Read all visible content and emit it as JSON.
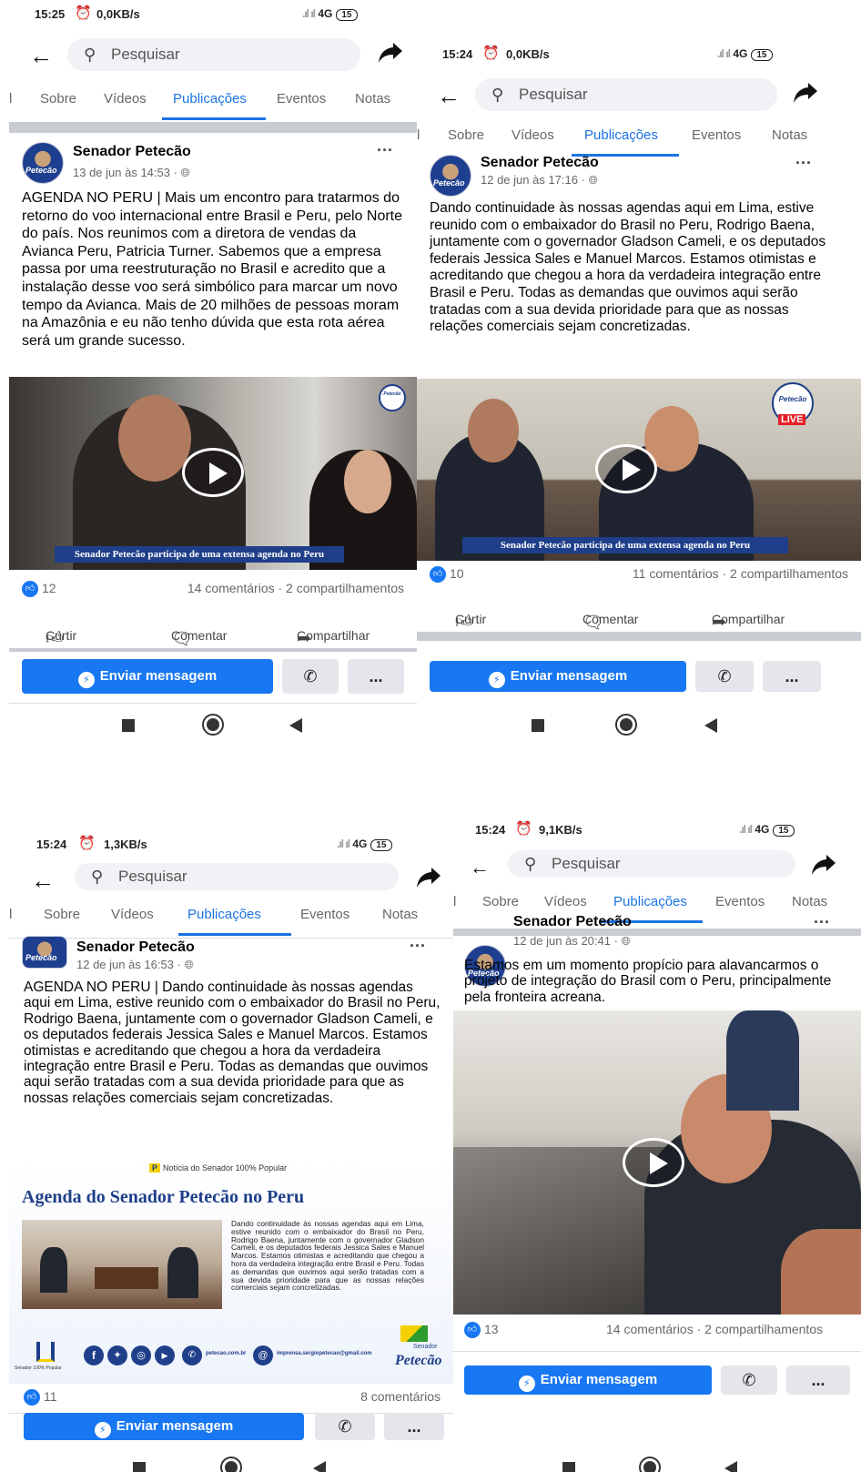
{
  "tabs": [
    "l",
    "Sobre",
    "Vídeos",
    "Publicações",
    "Eventos",
    "Notas"
  ],
  "search_placeholder": "Pesquisar",
  "page_name": "Senador Petecão",
  "actions": {
    "like": "Curtir",
    "comment": "Comentar",
    "share": "Compartilhar"
  },
  "message_button": "Enviar mensagem",
  "more_label": "...",
  "avatar_mark": "Petecão",
  "live_label": "LIVE",
  "video_caption": "Senador Petecão participa de uma extensa agenda no Peru",
  "panels": [
    {
      "status": {
        "time": "15:25",
        "speed": "0,0KB/s",
        "network": "4G",
        "battery": "15"
      },
      "post": {
        "date": "13 de jun às 14:53 · ",
        "text": "AGENDA NO PERU | Mais um encontro para tratarmos do retorno do voo internacional entre Brasil e Peru, pelo Norte do país. Nos reunimos com a diretora de vendas da Avianca Peru, Patricia Turner. Sabemos que a empresa passa por uma reestruturação no Brasil e acredito que a instalação desse voo será simbólico para marcar um novo tempo da Avianca. Mais de 20 milhões de pessoas moram na Amazônia e eu não tenho dúvida que esta rota aérea será um grande sucesso.",
        "likes": "12",
        "comments_shares": "14 comentários · 2 compartilhamentos"
      }
    },
    {
      "status": {
        "time": "15:24",
        "speed": "0,0KB/s",
        "network": "4G",
        "battery": "15"
      },
      "post": {
        "date": "12 de jun às 17:16 · ",
        "text": "Dando continuidade às nossas agendas aqui em Lima, estive reunido com o embaixador do Brasil no Peru, Rodrigo Baena, juntamente com o governador Gladson Cameli, e os deputados federais Jessica Sales e Manuel Marcos. Estamos otimistas e acreditando que chegou a hora da verdadeira integração entre Brasil e Peru. Todas as demandas que ouvimos aqui serão tratadas com a sua devida prioridade para que as nossas relações comerciais sejam concretizadas.",
        "likes": "10",
        "comments_shares": "11 comentários · 2 compartilhamentos"
      }
    },
    {
      "status": {
        "time": "15:24",
        "speed": "1,3KB/s",
        "network": "4G",
        "battery": "15"
      },
      "post": {
        "date": "12 de jun às 16:53 · ",
        "text": "AGENDA NO PERU | Dando continuidade às nossas agendas aqui em Lima, estive reunido com o embaixador do Brasil no Peru, Rodrigo Baena, juntamente com o governador Gladson Cameli, e os deputados federais Jessica Sales e Manuel Marcos. Estamos otimistas e acreditando que chegou a hora da verdadeira integração entre Brasil e Peru. Todas as demandas que ouvimos aqui serão tratadas com a sua devida prioridade para que as nossas relações comerciais sejam concretizadas.",
        "likes": "11",
        "comments_shares": "8 comentários"
      },
      "flyer": {
        "kicker": "Notícia do Senador 100% Popular",
        "title": "Agenda do Senador Petecão no Peru",
        "body": "Dando continuidade às nossas agendas aqui em Lima, estive reunido com o embaixador do Brasil no Peru, Rodrigo Baena, juntamente com o governador Gladson Cameli, e os deputados federais Jessica Sales e Manuel Marcos. Estamos otimistas e acreditando que chegou a hora da verdadeira integração entre Brasil e Peru. Todas as demandas que ouvimos aqui serão tratadas com a sua devida prioridade para que as nossas relações comerciais sejam concretizadas.",
        "site": "petecao.com.br",
        "email": "imprensa.sergiopetecao@gmail.com",
        "slogan": "Senador 100% Popular",
        "logo_kicker": "Senador",
        "logo": "Petecão"
      }
    },
    {
      "status": {
        "time": "15:24",
        "speed": "9,1KB/s",
        "network": "4G",
        "battery": "15"
      },
      "post": {
        "date": "12 de jun às 20:41 · ",
        "text": "Estamos em um momento propício para alavancarmos o projeto de integração do Brasil com o Peru, principalmente pela fronteira acreana.",
        "likes": "13",
        "comments_shares": "14 comentários · 2 compartilhamentos"
      }
    }
  ],
  "colors": {
    "accent": "#1b74e4",
    "button": "#1877f2",
    "flyer_title": "#1f3f8a"
  }
}
